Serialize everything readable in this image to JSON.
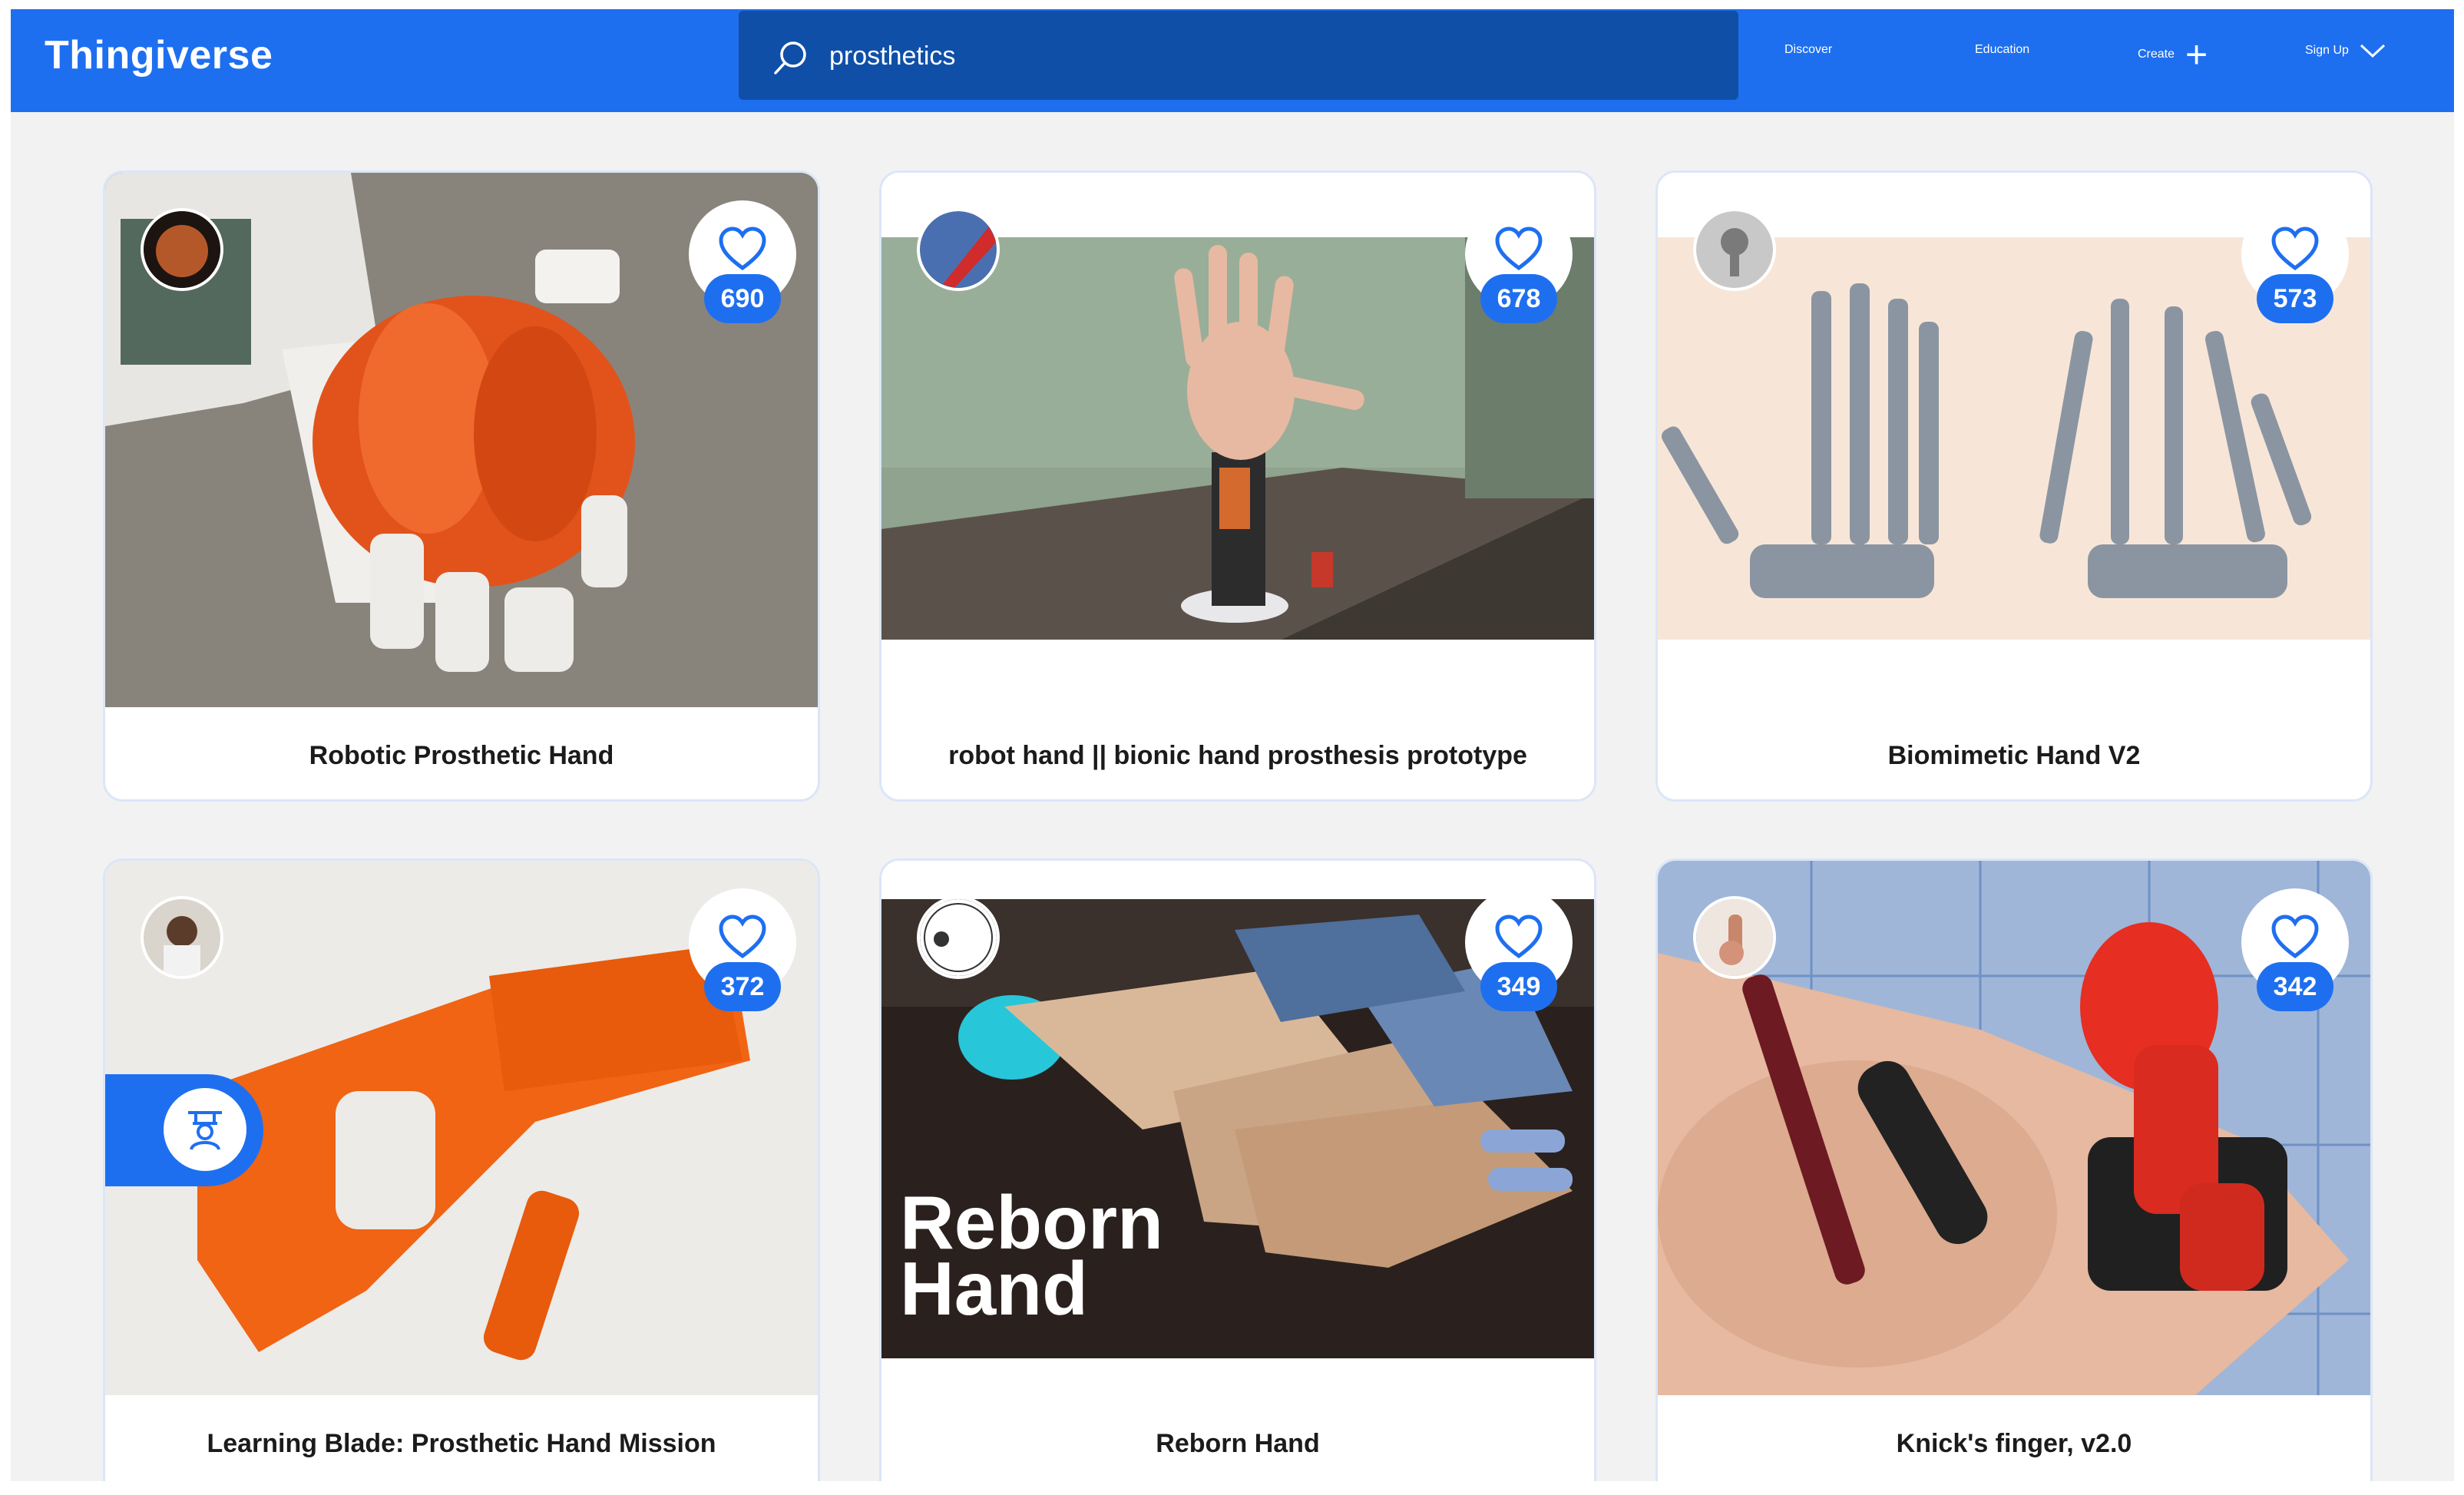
{
  "app": {
    "name": "Thingiverse"
  },
  "search": {
    "query": "prosthetics",
    "icon": "search-icon"
  },
  "nav": {
    "discover": "Discover",
    "education": "Education",
    "create": "Create",
    "signup": "Sign Up"
  },
  "colors": {
    "brand": "#1e6ff0",
    "search_bg": "#0f4fa8",
    "page_bg": "#f2f2f2"
  },
  "cards": [
    {
      "title": "Robotic Prosthetic Hand",
      "likes": "690"
    },
    {
      "title": "robot hand || bionic hand prosthesis prototype",
      "likes": "678"
    },
    {
      "title": "Biomimetic Hand V2",
      "likes": "573"
    },
    {
      "title": "Learning Blade: Prosthetic Hand Mission",
      "likes": "372"
    },
    {
      "title": "Reborn Hand",
      "likes": "349",
      "overlay_line1": "Reborn",
      "overlay_line2": "Hand"
    },
    {
      "title": "Knick's finger, v2.0",
      "likes": "342"
    }
  ]
}
